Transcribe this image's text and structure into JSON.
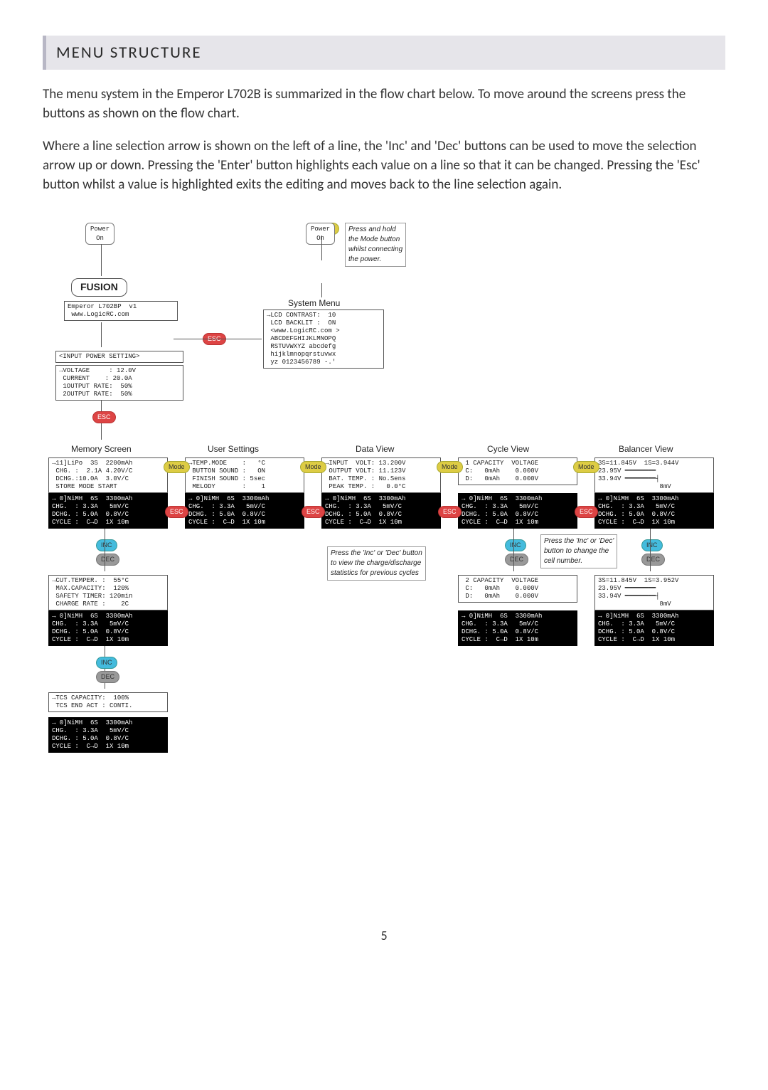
{
  "heading": "MENU STRUCTURE",
  "para1": "The menu system in the Emperor L702B is summarized in the flow chart below. To move around the screens press the buttons as shown on the flow chart.",
  "para2": "Where a line selection arrow is shown on the left of a line, the 'Inc' and 'Dec' buttons can be used to move the selection arrow up or down. Pressing the 'Enter' button highlights each value on a line so that it can be changed. Pressing the 'Esc' button whilst a value is highlighted exits the editing and moves back to the line selection again.",
  "chart": {
    "power_on": "Power\nOn",
    "power_on2": "Power\nOn",
    "hold_note": "Press and hold\nthe Mode button\nwhilst connecting\nthe power.",
    "fusion": "FUSION",
    "emperor": "Emperor L702BP  v1\n www.LogicRC.com",
    "sysmenu_label": "System Menu",
    "sysmenu": "→LCD CONTRAST:  10\n LCD BACKLIT :  ON\n <www.LogicRC.com >\n ABCDEFGHIJKLMNOPQ\n RSTUVWXYZ abcdefg\n hijklmnopqrstuvwx\n yz 0123456789 -.'",
    "input_title": "<INPUT POWER SETTING>",
    "input": "→VOLTAGE     : 12.0V\n CURRENT    : 20.0A\n 1OUTPUT RATE:  50%\n 2OUTPUT RATE:  50%",
    "mem_label": "Memory Screen",
    "user_label": "User Settings",
    "data_label": "Data View",
    "cycle_label": "Cycle View",
    "bal_label": "Balancer View",
    "mem": "→11]LiPo  3S  2200mAh\n CHG. :  2.1A 4.20V/C\n DCHG.:10.0A  3.0V/C\n STORE MODE START",
    "status": "→ 0]NiMH  6S  3300mAh\nCHG.  : 3.3A   5mV/C\nDCHG. : 5.0A  0.8V/C\nCYCLE :  C→D  1X 10m",
    "user1": "→TEMP.MODE    :   °C\n BUTTON SOUND :   ON\n FINISH SOUND : 5sec\n MELODY       :    1",
    "user2": "→CUT.TEMPER. :  55°C\n MAX.CAPACITY:  120%\n SAFETY TIMER: 120min\n CHARGE RATE :    2C",
    "user3": "→TCS CAPACITY:  100%\n TCS END ACT : CONTI.",
    "data": "→INPUT  VOLT: 13.200V\n OUTPUT VOLT: 11.123V\n BAT. TEMP. : No.Sens\n PEAK TEMP. :   0.0°C",
    "cycle1": " 1 CAPACITY  VOLTAGE\n C:   0mAh    0.000V\n D:   0mAh    0.000V",
    "cycle2": " 2 CAPACITY  VOLTAGE\n C:   0mAh    0.000V\n D:   0mAh    0.000V",
    "bal1": "3S=11.845V  1S=3.944V\n23.95V ━━━━━━━━\n33.94V ━━━━━━━━┤\n                8mV",
    "bal2": "3S=11.845V  1S=3.952V\n23.95V ━━━━━━━━\n33.94V ━━━━━━━━┤\n                8mV",
    "cycle_note": "Press the 'Inc' or 'Dec' button\nto view the charge/discharge\nstatistics for previous cycles",
    "bal_note": "Press the 'Inc' or 'Dec'\nbutton to change the\ncell number.",
    "mode_btn": "Mode",
    "esc_btn": "ESC",
    "inc_btn": "INC",
    "dec_btn": "DEC"
  },
  "pageno": "5"
}
